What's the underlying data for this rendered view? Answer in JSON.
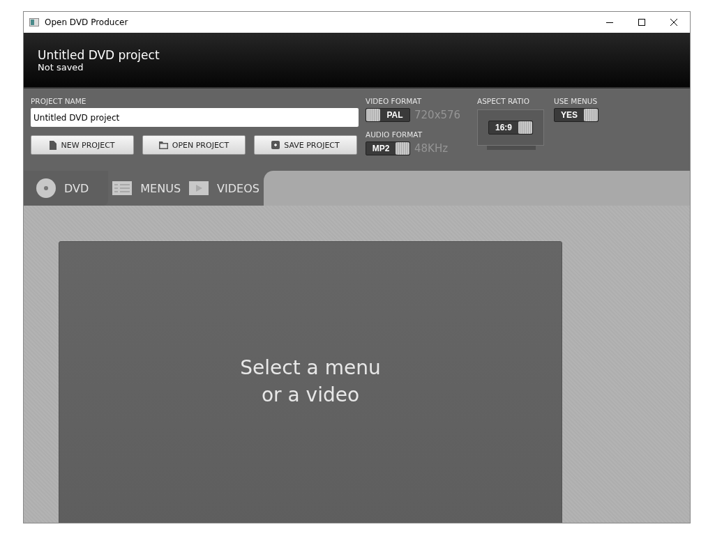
{
  "window": {
    "title": "Open DVD Producer"
  },
  "header": {
    "title": "Untitled DVD project",
    "status": "Not saved"
  },
  "project_name": {
    "label": "PROJECT NAME",
    "value": "Untitled DVD project"
  },
  "buttons": [
    {
      "label": "NEW PROJECT",
      "kind": "new"
    },
    {
      "label": "OPEN PROJECT",
      "kind": "open"
    },
    {
      "label": "SAVE PROJECT",
      "kind": "save"
    }
  ],
  "video_format": {
    "label": "VIDEO FORMAT",
    "value": "PAL",
    "on": false,
    "detail": "720x576"
  },
  "audio_format": {
    "label": "AUDIO FORMAT",
    "value": "MP2",
    "on": true,
    "detail": "48KHz"
  },
  "aspect_ratio": {
    "label": "ASPECT RATIO",
    "value": "16:9",
    "on": true
  },
  "use_menus": {
    "label": "USE MENUS",
    "value": "YES",
    "on": true
  },
  "tabs": [
    {
      "label": "DVD",
      "kind": "disc",
      "selected": true
    },
    {
      "label": "MENUS",
      "kind": "list",
      "selected": false
    },
    {
      "label": "VIDEOS",
      "kind": "play",
      "selected": false
    }
  ],
  "preview": {
    "message": "Select a menu\nor a video"
  }
}
